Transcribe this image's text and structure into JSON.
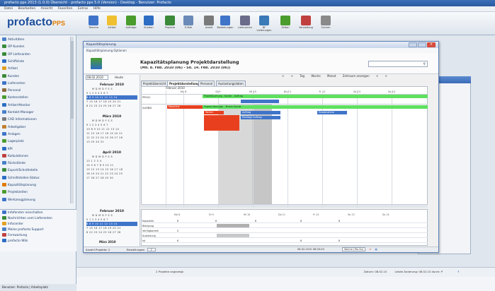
{
  "window": {
    "title": "profacto pps 2013 (1.0.0) Übersicht - profacto pps 5.0 (Version) - Desktop - Benutzer: Profacto",
    "menu": [
      "Datei",
      "Bearbeiten",
      "Ansicht",
      "Favoriten",
      "Extras",
      "Hilfe"
    ]
  },
  "toolbar": {
    "logo_main": "profacto",
    "logo_suffix": "PPS",
    "buttons": [
      {
        "label": "Termine",
        "icon": "calendar-icon",
        "color": "#3f74c9"
      },
      {
        "label": "Artikel",
        "icon": "article-icon",
        "color": "#f0c030"
      },
      {
        "label": "Aufträge",
        "icon": "order-icon",
        "color": "#4a9c2d"
      },
      {
        "label": "Kunden",
        "icon": "customer-icon",
        "color": "#2d6dc4"
      },
      {
        "label": "Projekte",
        "icon": "project-icon",
        "color": "#3a8a3a"
      },
      {
        "label": "E-Mail",
        "icon": "mail-icon",
        "color": "#6a8ab8"
      },
      {
        "label": "Arbeit",
        "icon": "work-icon",
        "color": "#7a7a7a"
      },
      {
        "label": "Bestellungen",
        "icon": "purchase-icon",
        "color": "#3f74c9"
      },
      {
        "label": "Lieferanten",
        "icon": "supplier-icon",
        "color": "#6a6a8a"
      },
      {
        "label": "BF Lieferungen",
        "icon": "delivery-icon",
        "color": "#3a7ab8"
      },
      {
        "label": "Zeiten",
        "icon": "time-icon",
        "color": "#4a9c2d"
      },
      {
        "label": "Verwaltung",
        "icon": "admin-icon",
        "color": "#c04040"
      },
      {
        "label": "Suchen",
        "icon": "search-icon",
        "color": "#8a8a8a"
      }
    ]
  },
  "sidebar": {
    "items": [
      {
        "label": "Aktivitäten",
        "color": "#4a80c8"
      },
      {
        "label": "OP Kunden",
        "color": "#3a8a3a"
      },
      {
        "label": "OP Lieferanten",
        "color": "#3a8a3a"
      },
      {
        "label": "Schiffsliste",
        "color": "#2d6dc4"
      },
      {
        "label": "Artikel",
        "color": "#e0a020"
      },
      {
        "label": "Kunden",
        "color": "#3a8a3a"
      },
      {
        "label": "Lieferanten",
        "color": "#3f74c9"
      },
      {
        "label": "Personal",
        "color": "#8a6a3a"
      },
      {
        "label": "Kostenstellen",
        "color": "#4a9c2d"
      },
      {
        "label": "Artikel-Monitor",
        "color": "#2d6dc4"
      },
      {
        "label": "Kontakt-Manager",
        "color": "#4a80c8"
      },
      {
        "label": "CAD Informationen",
        "color": "#7a7a7a"
      },
      {
        "label": "Arbeitgeber",
        "color": "#c08030"
      },
      {
        "label": "Anlagen",
        "color": "#3f74c9"
      },
      {
        "label": "Lagerplatz",
        "color": "#4a9c2d"
      },
      {
        "label": "KPI",
        "color": "#2d6dc4"
      },
      {
        "label": "Kalkulationen",
        "color": "#c04040"
      },
      {
        "label": "Rückstände",
        "color": "#4a80c8"
      },
      {
        "label": "Export/Schnittstelle",
        "color": "#3a8a3a"
      },
      {
        "label": "Schnittstellen-Status",
        "color": "#2d6dc4"
      },
      {
        "label": "Kapazitätsplanung",
        "color": "#e07b00"
      },
      {
        "label": "Projektzeiten",
        "color": "#4a9c2d"
      },
      {
        "label": "Werkzeugplanung",
        "color": "#3f74c9"
      }
    ],
    "lower_items": [
      {
        "label": "Infofenster einschalten",
        "color": "#3f74c9"
      },
      {
        "label": "Nachrichten vom Lieferanten",
        "color": "#3a8a3a"
      },
      {
        "label": "Infocenter",
        "color": "#e0a020"
      },
      {
        "label": "Meine profacto Support",
        "color": "#4a80c8"
      },
      {
        "label": "Fernwartung",
        "color": "#c04040"
      },
      {
        "label": "profacto Wiki",
        "color": "#2d6dc4"
      }
    ],
    "status": "Benutzer: Profacto | Arbeitsplatz"
  },
  "dialog": {
    "title": "Kapazitätsplanung",
    "menu": "Kapazitätsplanung    Optionen",
    "heading": "Kapazitätsplanung Projektdarstellung",
    "subheading": "(Mo. 8. Feb. 2010 (06) - So. 14. Feb. 2010 (06))",
    "search_icon": "magnifier-icon",
    "date_value": "08.02.2010",
    "today_label": "Heute",
    "nav": [
      "<",
      ">",
      "Tag",
      "Woche",
      "Monat",
      "Zeitraum anzeigen",
      "<",
      ">"
    ],
    "tabs": [
      "Projektübersicht",
      "Projektdarstellung",
      "Personal",
      "Auslastungsdaten"
    ],
    "active_tab": 1,
    "month_label": "Februar 2010",
    "day_headers": [
      "Mo 8",
      "Di 9",
      "Mi 10",
      "Do 11",
      "Fr 12",
      "Sa 13",
      "So 14"
    ],
    "rows": [
      "PROJ1",
      "AUSBD"
    ],
    "bars": [
      {
        "label": "Projektbuchung - Kunde - Auftrag",
        "color": "#5ee05e",
        "row": 0
      },
      {
        "label": "",
        "color": "#3f74c9",
        "row": 0
      },
      {
        "label": "Maschine",
        "color": "#e8401f",
        "row": 1
      },
      {
        "label": "Projekt Montage - Termin Kunde",
        "color": "#5ee05e",
        "row": 1
      },
      {
        "label": "Termin",
        "color": "#e8401f",
        "row": 1
      },
      {
        "label": "Auftrag",
        "color": "#3f74c9",
        "row": 1
      },
      {
        "label": "Montage Auftrag",
        "color": "#3f74c9",
        "row": 1
      },
      {
        "label": "Endabnahme",
        "color": "#3f74c9",
        "row": 1
      }
    ],
    "calendars": [
      {
        "title": "Februar 2010",
        "days": "M D M D F S S",
        "weeks": [
          "5  1 2 3 4 5 6 7",
          "6  8 9 10 11 12 13 14",
          "7  15 16 17 18 19 20 21",
          "8  22 23 24 25 26 27 28"
        ]
      },
      {
        "title": "März 2010",
        "days": "M D M D F S S",
        "weeks": [
          "9  1 2 3 4 5 6 7",
          "10  8 9 10 11 12 13 14",
          "11  15 16 17 18 19 20 21",
          "12  22 23 24 25 26 27 28",
          "13  29 30 31"
        ]
      },
      {
        "title": "April 2010",
        "days": "M D M D F S S",
        "weeks": [
          "13  1 2 3 4",
          "14  5 6 7 8 9 10 11",
          "15  12 13 14 15 16 17 18",
          "16  19 20 21 22 23 24 25",
          "17  26 27 28 29 30"
        ]
      },
      {
        "title": "Februar 2010",
        "days": "M D M D F S S",
        "weeks": [
          "5  1 2 3 4 5 6 7",
          "6  8 9 10 11 12 13 14",
          "7  15 16 17 18 19 20 21",
          "8  22 23 24 25 26 27 28"
        ]
      }
    ],
    "bottom_calendar_footer": "März 2010",
    "lower_rows": [
      {
        "label": "Kapazität",
        "values": [
          "8",
          "8",
          "8",
          "8",
          "8"
        ]
      },
      {
        "label": "Belegung",
        "values": [
          "",
          "",
          "",
          "",
          ""
        ]
      },
      {
        "label": "Verfügbarkeit",
        "values": [
          "0",
          "",
          "",
          "",
          ""
        ]
      },
      {
        "label": "Auslastung",
        "values": [
          "",
          "",
          "",
          "",
          ""
        ]
      },
      {
        "label": "Ist",
        "values": [
          "8",
          "",
          "",
          "8",
          "8"
        ]
      }
    ],
    "status_left": "Anzahl Projekte: 2",
    "zoom_label": "Einstellungen",
    "zoom_value": "7",
    "status_right": "08.02.2010 08:00:00",
    "status_right2": "Woche (Mo-So)",
    "colors": {
      "accent": "#3f74c9",
      "green": "#5ee05e",
      "red": "#e8401f"
    }
  },
  "app_status": {
    "left": "2 Projekte angezeigt",
    "right_a": "Datum: 08.02.10",
    "right_b": "Letzte Änderung: 08.02.10 durch: P",
    "help_icon": "help-icon"
  }
}
